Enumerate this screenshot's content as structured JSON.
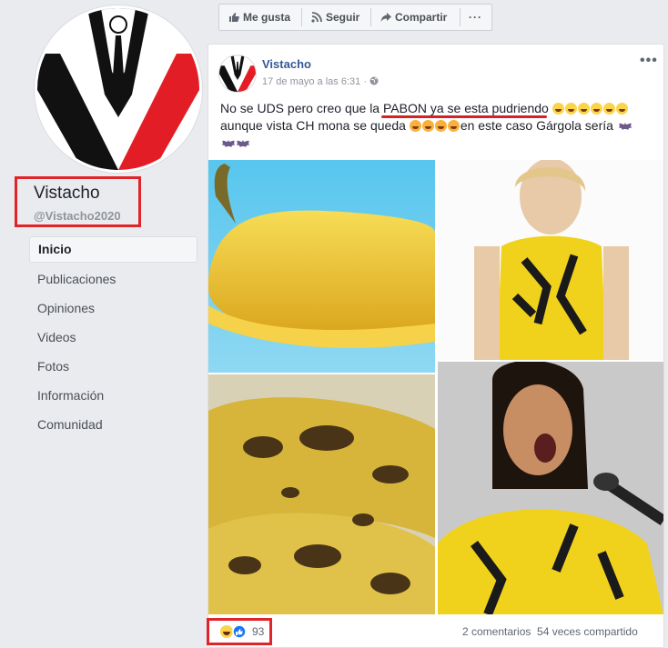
{
  "page": {
    "name": "Vistacho",
    "handle": "@Vistacho2020"
  },
  "nav": {
    "items": [
      "Inicio",
      "Publicaciones",
      "Opiniones",
      "Videos",
      "Fotos",
      "Información",
      "Comunidad"
    ],
    "active": "Inicio"
  },
  "actions": {
    "like": "Me gusta",
    "follow": "Seguir",
    "share": "Compartir",
    "more": "···"
  },
  "post": {
    "author": "Vistacho",
    "time": "17 de mayo a las 6:31",
    "time_sep": "·",
    "more": "•••",
    "text_part1": "No se UDS pero creo que la ",
    "text_underlined": "PABON ya se esta pudriendo",
    "text_part2": "aunque vista CH mona se queda",
    "text_part3": "en este caso Gárgola sería",
    "reactions_count": "93",
    "comments": "2 comentarios",
    "shares": "54 veces compartido"
  },
  "colors": {
    "accent_red": "#e0242a",
    "link_blue": "#365899",
    "banana_yellow": "#f2cf3c",
    "dress_yellow": "#f0d21c"
  }
}
